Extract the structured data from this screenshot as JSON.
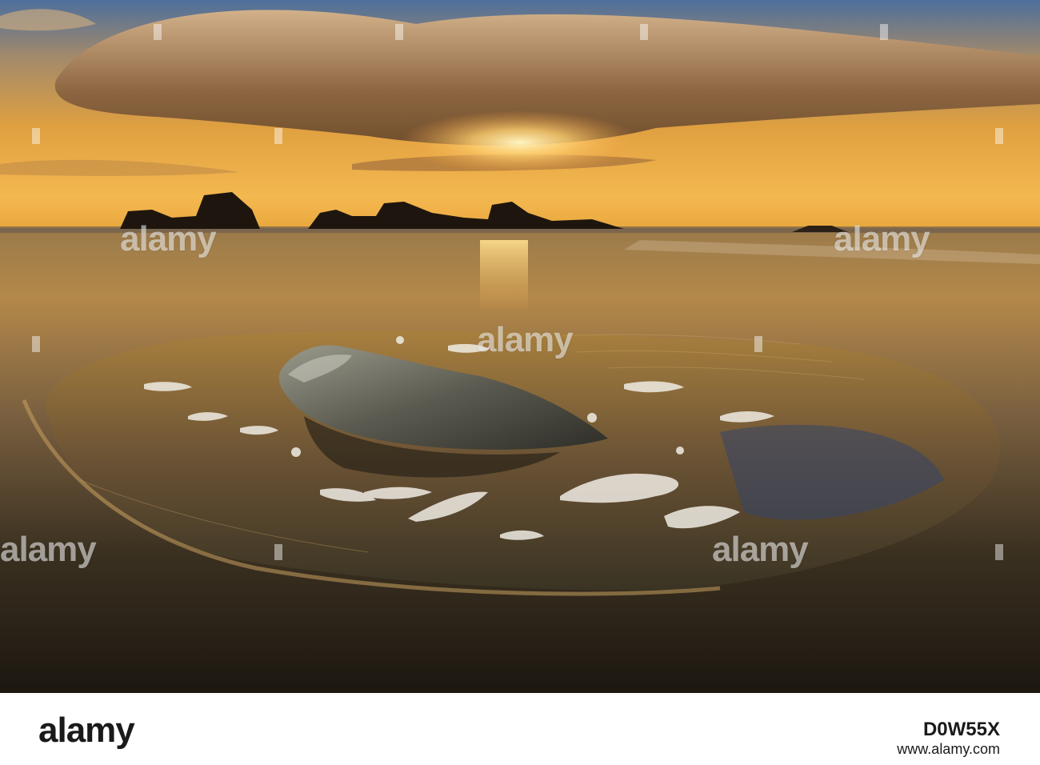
{
  "watermark": {
    "text": "alamy"
  },
  "footer": {
    "logo": "alamy",
    "image_id": "D0W55X",
    "domain": "www.alamy.com"
  },
  "colors": {
    "sky_top": "#5d7fa8",
    "sunset_glow": "#f0a838",
    "sand_dark": "#2a2217",
    "water_gold": "#b47d36"
  }
}
